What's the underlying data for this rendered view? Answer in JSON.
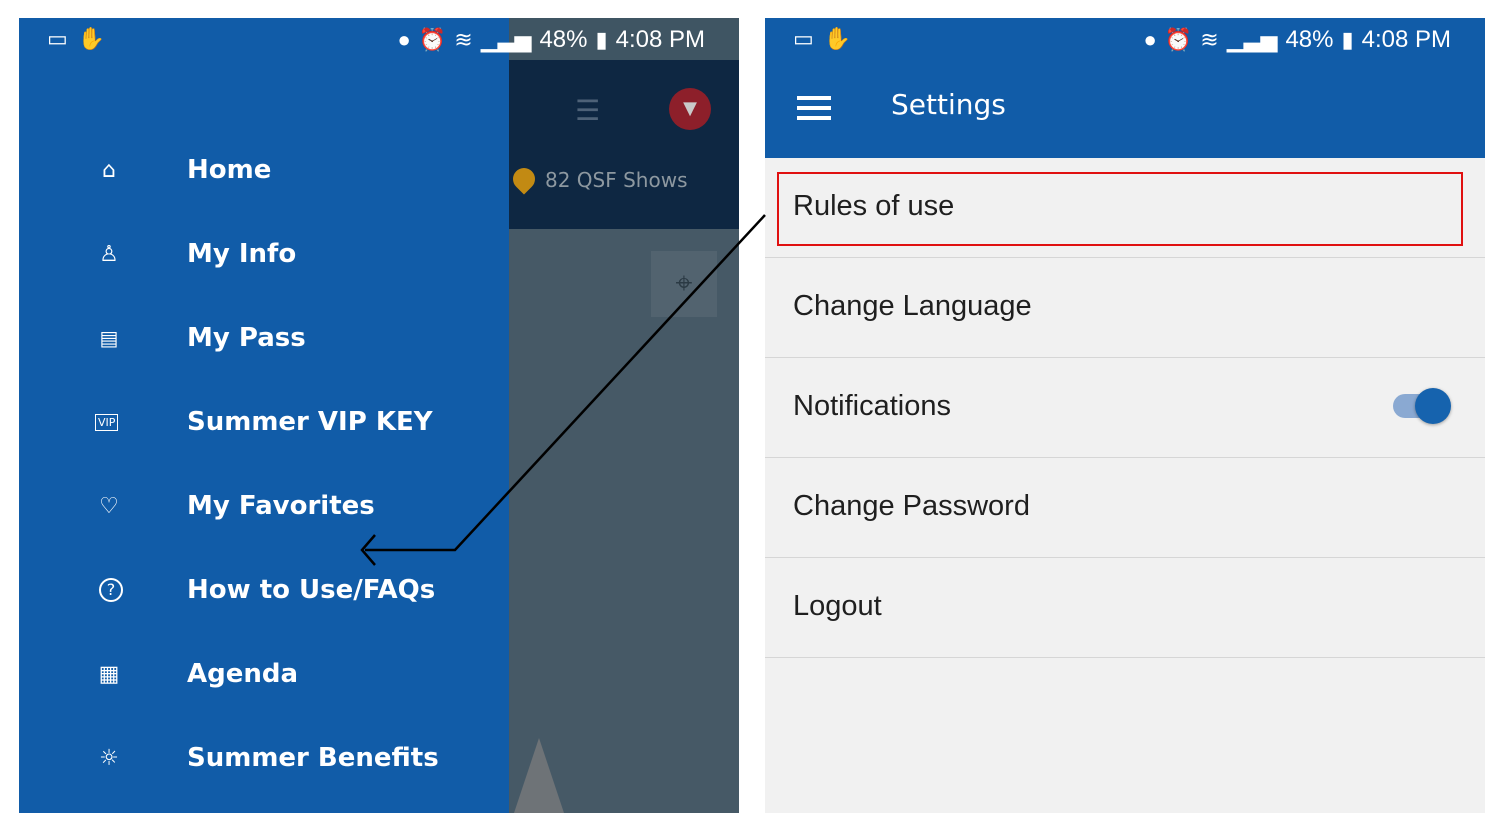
{
  "status_bar": {
    "battery": "48%",
    "time": "4:08 PM",
    "left_icons": [
      "laptop-icon",
      "hand-icon"
    ],
    "right_icons": [
      "location-pin-icon",
      "alarm-icon",
      "wifi-icon",
      "signal-icon",
      "battery-icon"
    ]
  },
  "left_screen": {
    "drawer_color": "#115ca8",
    "menu": [
      {
        "label": "Home",
        "icon": "home-icon",
        "glyph": "⌂"
      },
      {
        "label": "My Info",
        "icon": "person-icon",
        "glyph": "♙"
      },
      {
        "label": "My Pass",
        "icon": "id-card-icon",
        "glyph": "▤"
      },
      {
        "label": "Summer VIP KEY",
        "icon": "vip-ticket-icon",
        "glyph": "VIP"
      },
      {
        "label": "My Favorites",
        "icon": "heart-icon",
        "glyph": "♡"
      },
      {
        "label": "How to Use/FAQs",
        "icon": "help-icon",
        "glyph": "?"
      },
      {
        "label": "Agenda",
        "icon": "calendar-icon",
        "glyph": "▦"
      },
      {
        "label": "Summer Benefits",
        "icon": "sun-icon",
        "glyph": "☼"
      }
    ],
    "map": {
      "shows_label": "82 QSF Shows",
      "icons": [
        "list-icon",
        "filter-icon",
        "locate-icon",
        "map-pin-icon"
      ]
    }
  },
  "right_screen": {
    "title": "Settings",
    "settings": [
      {
        "label": "Rules of use",
        "highlighted": true
      },
      {
        "label": "Change Language"
      },
      {
        "label": "Notifications",
        "toggle": "on"
      },
      {
        "label": "Change Password"
      },
      {
        "label": "Logout"
      }
    ],
    "highlight_color": "#e01010",
    "accent": "#1663ae"
  }
}
